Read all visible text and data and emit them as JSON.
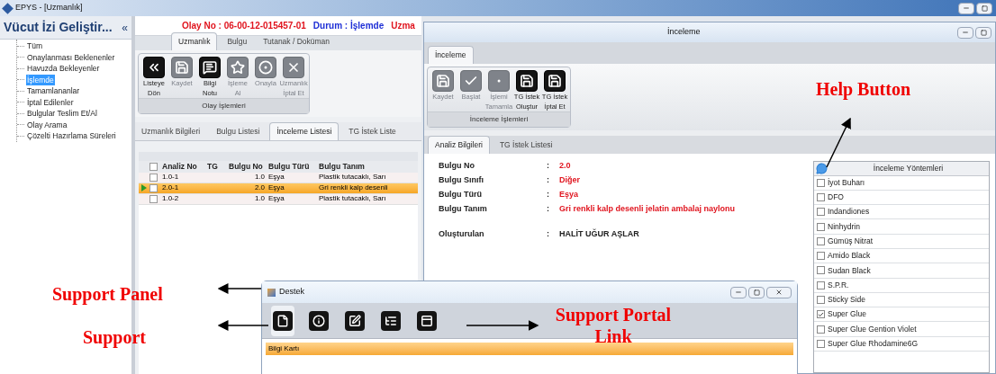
{
  "app_window": {
    "title": "EPYS - [Uzmanlık]"
  },
  "sidebar": {
    "title": "Vücut İzi Geliştir...",
    "collapse": "«",
    "items": [
      {
        "label": "Tüm",
        "selected": false
      },
      {
        "label": "Onaylanması Beklenenler",
        "selected": false
      },
      {
        "label": "Havuzda Bekleyenler",
        "selected": false
      },
      {
        "label": "İşlemde",
        "selected": true
      },
      {
        "label": "Tamamlananlar",
        "selected": false
      },
      {
        "label": "İptal Edilenler",
        "selected": false
      },
      {
        "label": "Bulgular Teslim Et/Al",
        "selected": false
      },
      {
        "label": "Olay Arama",
        "selected": false
      },
      {
        "label": "Çözelti Hazırlama Süreleri",
        "selected": false
      }
    ]
  },
  "main": {
    "header": [
      {
        "text": "Olay No : 06-00-12-015457-01",
        "color": "#e0141e"
      },
      {
        "text": "Durum : İşlemde",
        "color": "#1e2fd6"
      },
      {
        "text": "Uzma",
        "color": "#e0141e"
      }
    ],
    "tabs": [
      {
        "label": "Uzmanlık",
        "selected": true
      },
      {
        "label": "Bulgu",
        "selected": false
      },
      {
        "label": "Tutanak / Doküman",
        "selected": false
      }
    ],
    "ribbon": {
      "group": "Olay İşlemleri",
      "buttons": [
        {
          "lines": [
            "Listeye",
            "Dön"
          ],
          "disabled": false
        },
        {
          "lines": [
            "Kaydet"
          ],
          "disabled": true
        },
        {
          "lines": [
            "Bilgi",
            "Notu"
          ],
          "disabled": false
        },
        {
          "lines": [
            "İşleme",
            "Al"
          ],
          "disabled": true
        },
        {
          "lines": [
            "Onayla"
          ],
          "disabled": true
        },
        {
          "lines": [
            "Uzmanlık",
            "İptal Et"
          ],
          "disabled": true
        }
      ]
    },
    "subtabs": [
      {
        "label": "Uzmanlık Bilgileri",
        "selected": false
      },
      {
        "label": "Bulgu Listesi",
        "selected": false
      },
      {
        "label": "İnceleme Listesi",
        "selected": true
      },
      {
        "label": "TG İstek Liste",
        "selected": false
      }
    ],
    "table": {
      "header_checked": false,
      "columns": [
        "Analiz No",
        "TG",
        "Bulgu No",
        "Bulgu Türü",
        "Bulgu Tanım"
      ],
      "rows": [
        {
          "cells": [
            "1.0-1",
            "",
            "1.0",
            "Eşya",
            "Plastik tutacaklı, Sarı"
          ],
          "selected": false,
          "checked": false
        },
        {
          "cells": [
            "2.0-1",
            "",
            "2.0",
            "Eşya",
            "Gri renkli kalp desenli"
          ],
          "selected": true,
          "checked": false
        },
        {
          "cells": [
            "1.0-2",
            "",
            "1.0",
            "Eşya",
            "Plastik tutacaklı, Sarı"
          ],
          "selected": false,
          "checked": false
        }
      ]
    }
  },
  "inceleme_window": {
    "title": "İnceleme",
    "tabs": [
      {
        "label": "İnceleme",
        "selected": true
      }
    ],
    "ribbon": {
      "group": "İnceleme İşlemleri",
      "buttons": [
        {
          "lines": [
            "Kaydet"
          ],
          "disabled": true
        },
        {
          "lines": [
            "Başlat"
          ],
          "disabled": true
        },
        {
          "lines": [
            "İşlemi",
            "Tamamla"
          ],
          "disabled": true
        },
        {
          "lines": [
            "TG İstek",
            "Oluştur"
          ],
          "disabled": false
        },
        {
          "lines": [
            "TG İstek",
            "İptal Et"
          ],
          "disabled": false
        }
      ]
    },
    "subtabs": [
      {
        "label": "Analiz Bilgileri",
        "selected": true
      },
      {
        "label": "TG İstek Listesi",
        "selected": false
      }
    ],
    "fields": [
      {
        "label": "Bulgu No",
        "separator": ":",
        "value": "2.0",
        "highlight": true
      },
      {
        "label": "Bulgu Sınıfı",
        "separator": ":",
        "value": "Diğer",
        "highlight": true
      },
      {
        "label": "Bulgu Türü",
        "separator": ":",
        "value": "Eşya",
        "highlight": true
      },
      {
        "label": "Bulgu Tanım",
        "separator": ":",
        "value": "Gri renkli kalp desenli jelatin ambalaj naylonu",
        "highlight": true
      },
      {
        "label": "Oluşturulan",
        "separator": ":",
        "value": "HALİT UĞUR AŞLAR",
        "highlight": false
      }
    ],
    "methods": {
      "title": "İnceleme Yöntemleri",
      "items": [
        {
          "label": "İyot Buharı",
          "checked": false
        },
        {
          "label": "DFO",
          "checked": false
        },
        {
          "label": "Indandiones",
          "checked": false
        },
        {
          "label": "Ninhydrin",
          "checked": false
        },
        {
          "label": "Gümüş Nitrat",
          "checked": false
        },
        {
          "label": "Amido Black",
          "checked": false
        },
        {
          "label": "Sudan Black",
          "checked": false
        },
        {
          "label": "S.P.R.",
          "checked": false
        },
        {
          "label": "Sticky Side",
          "checked": false
        },
        {
          "label": "Super Glue",
          "checked": true
        },
        {
          "label": "Super Glue Gention Violet",
          "checked": false
        },
        {
          "label": "Super Glue Rhodamine6G",
          "checked": false
        }
      ]
    }
  },
  "destek_window": {
    "title": "Destek",
    "rows": [
      {
        "label": "Bilgi Kartı",
        "selected": true
      }
    ]
  },
  "annotations": [
    "Help Button",
    "Support Panel",
    "Support",
    "Support Portal Link"
  ]
}
